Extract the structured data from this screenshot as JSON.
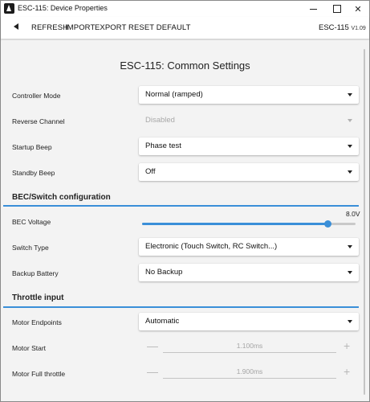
{
  "window": {
    "title": "ESC-115: Device Properties"
  },
  "toolbar": {
    "refresh": "REFRESH",
    "import": "IMPORT",
    "export": "EXPORT",
    "reset_default": "RESET DEFAULT",
    "device": "ESC-115",
    "version": "V1.09"
  },
  "page": {
    "title": "ESC-115: Common Settings"
  },
  "common": {
    "controller_mode": {
      "label": "Controller Mode",
      "value": "Normal (ramped)"
    },
    "reverse_channel": {
      "label": "Reverse Channel",
      "value": "Disabled",
      "disabled": true
    },
    "startup_beep": {
      "label": "Startup Beep",
      "value": "Phase test"
    },
    "standby_beep": {
      "label": "Standby Beep",
      "value": "Off"
    }
  },
  "bec": {
    "section_title": "BEC/Switch configuration",
    "bec_voltage": {
      "label": "BEC Voltage",
      "value_text": "8.0V",
      "level": 0.87
    },
    "switch_type": {
      "label": "Switch Type",
      "value": "Electronic (Touch Switch, RC Switch...)"
    },
    "backup_battery": {
      "label": "Backup Battery",
      "value": "No Backup"
    }
  },
  "throttle": {
    "section_title": "Throttle input",
    "motor_endpoints": {
      "label": "Motor Endpoints",
      "value": "Automatic"
    },
    "motor_start": {
      "label": "Motor Start",
      "value": "1.100ms"
    },
    "motor_full_throttle": {
      "label": "Motor Full throttle",
      "value": "1.900ms"
    }
  },
  "icons": {
    "back": "back-arrow-icon",
    "dropdown": "caret-down-icon",
    "minus": "minus-icon",
    "plus": "plus-icon"
  },
  "colors": {
    "accent": "#3a8fd8",
    "background": "#f3f3f3",
    "disabled_text": "#a8a8a8"
  },
  "stepper_symbols": {
    "minus": "—",
    "plus": "+"
  }
}
